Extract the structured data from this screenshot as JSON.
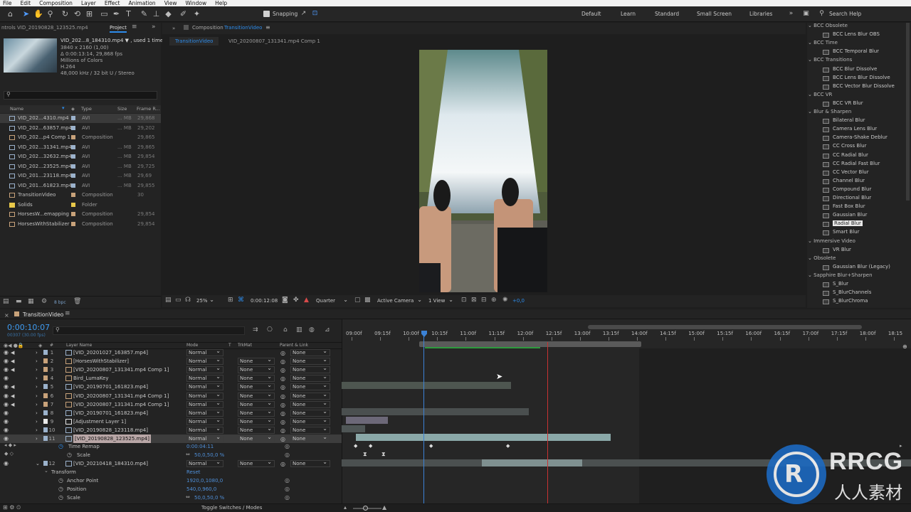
{
  "menu": [
    "File",
    "Edit",
    "Composition",
    "Layer",
    "Effect",
    "Animation",
    "View",
    "Window",
    "Help"
  ],
  "toolbar": {
    "snapping_label": "Snapping",
    "workspaces": [
      "Default",
      "Learn",
      "Standard",
      "Small Screen",
      "Libraries"
    ],
    "search_placeholder": "Search Help"
  },
  "project_panel": {
    "left_tab": "ntrols VID_20190828_123525.mp4",
    "tab": "Project",
    "preview": {
      "name": "VID_202...8_184310.mp4 ▼ , used 1 time",
      "res": "3840 x 2160 (1,00)",
      "duration": "Δ 0:00:13:14, 29,868 fps",
      "colors": "Millions of Colors",
      "codec": "H.264",
      "audio": "48,000 kHz / 32 bit U / Stereo"
    },
    "search_placeholder": "",
    "columns": [
      "Name",
      "Type",
      "Size",
      "Frame R..."
    ],
    "items": [
      {
        "name": "VID_202...4310.mp4",
        "type": "AVI",
        "size": "... MB",
        "rate": "29,868",
        "color": "#9bb2cc",
        "selected": true
      },
      {
        "name": "VID_202...63857.mp4",
        "type": "AVI",
        "size": "... MB",
        "rate": "29,202",
        "color": "#9bb2cc"
      },
      {
        "name": "VID_202...p4 Comp 1",
        "type": "Composition",
        "size": "",
        "rate": "29,865",
        "color": "#c8a27a"
      },
      {
        "name": "VID_202...31341.mp4",
        "type": "AVI",
        "size": "... MB",
        "rate": "29,865",
        "color": "#9bb2cc"
      },
      {
        "name": "VID_202...32632.mp4",
        "type": "AVI",
        "size": "... MB",
        "rate": "29,854",
        "color": "#9bb2cc"
      },
      {
        "name": "VID_202...23525.mp4",
        "type": "AVI",
        "size": "... MB",
        "rate": "29,725",
        "color": "#9bb2cc"
      },
      {
        "name": "VID_201...23118.mp4",
        "type": "AVI",
        "size": "... MB",
        "rate": "29,69",
        "color": "#9bb2cc"
      },
      {
        "name": "VID_201...61823.mp4",
        "type": "AVI",
        "size": "... MB",
        "rate": "29,855",
        "color": "#9bb2cc"
      },
      {
        "name": "TransitionVideo",
        "type": "Composition",
        "size": "",
        "rate": "30",
        "color": "#c8a27a"
      },
      {
        "name": "Solids",
        "type": "Folder",
        "size": "",
        "rate": "",
        "color": "#e8c84a"
      },
      {
        "name": "HorsesW...emapping",
        "type": "Composition",
        "size": "",
        "rate": "29,854",
        "color": "#c8a27a"
      },
      {
        "name": "HorsesWithStabilizer",
        "type": "Composition",
        "size": "",
        "rate": "29,854",
        "color": "#c8a27a"
      }
    ],
    "bpc": "8 bpc"
  },
  "composition_panel": {
    "header": "Composition",
    "comp_name": "TransitionVideo",
    "tabs": [
      "TransitionVideo",
      "VID_20200807_131341.mp4 Comp 1"
    ],
    "zoom": "25%",
    "timecode": "0:00:12:08",
    "resolution": "Quarter",
    "camera": "Active Camera",
    "views": "1 View",
    "exposure": "+0,0"
  },
  "effects_panel": {
    "groups": [
      {
        "name": "BCC Obsolete",
        "items": [
          "BCC Lens Blur OBS"
        ]
      },
      {
        "name": "BCC Time",
        "items": [
          "BCC Temporal Blur"
        ]
      },
      {
        "name": "BCC Transitions",
        "items": [
          "BCC Blur Dissolve",
          "BCC Lens Blur Dissolve",
          "BCC Vector Blur Dissolve"
        ]
      },
      {
        "name": "BCC VR",
        "items": [
          "BCC VR Blur"
        ]
      },
      {
        "name": "Blur & Sharpen",
        "items": [
          "Bilateral Blur",
          "Camera Lens Blur",
          "Camera-Shake Deblur",
          "CC Cross Blur",
          "CC Radial Blur",
          "CC Radial Fast Blur",
          "CC Vector Blur",
          "Channel Blur",
          "Compound Blur",
          "Directional Blur",
          "Fast Box Blur",
          "Gaussian Blur",
          "Radial Blur",
          "Smart Blur"
        ]
      },
      {
        "name": "Immersive Video",
        "items": [
          "VR Blur"
        ]
      },
      {
        "name": "Obsolete",
        "items": [
          "Gaussian Blur (Legacy)"
        ]
      },
      {
        "name": "Sapphire Blur+Sharpen",
        "items": [
          "S_Blur",
          "S_BlurChannels",
          "S_BlurChroma"
        ]
      }
    ],
    "selected": "Radial Blur"
  },
  "timeline": {
    "tab": "TransitionVideo",
    "timecode": "0:00:10:07",
    "frame_info": "00307 (30.00 fps)",
    "columns": {
      "layer_name": "Layer Name",
      "mode": "Mode",
      "t": "T",
      "trkmat": "TrkMat",
      "parent": "Parent & Link"
    },
    "ruler": [
      "09:00f",
      "09:15f",
      "10:00f",
      "10:15f",
      "11:00f",
      "11:15f",
      "12:00f",
      "12:15f",
      "13:00f",
      "13:15f",
      "14:00f",
      "14:15f",
      "15:00f",
      "15:15f",
      "16:00f",
      "16:15f",
      "17:00f",
      "17:15f",
      "18:00f",
      "18:15"
    ],
    "layers": [
      {
        "num": "1",
        "name": "[VID_20201027_163857.mp4]",
        "mode": "Normal",
        "trkmat": "",
        "parent": "None",
        "color": "#9bb2cc"
      },
      {
        "num": "2",
        "name": "[HorsesWithStabilizer]",
        "mode": "Normal",
        "trkmat": "None",
        "parent": "None",
        "color": "#c8a27a"
      },
      {
        "num": "3",
        "name": "[VID_20200807_131341.mp4 Comp 1]",
        "mode": "Normal",
        "trkmat": "None",
        "parent": "None",
        "color": "#c8a27a"
      },
      {
        "num": "4",
        "name": "Bird_LumaKey",
        "mode": "Normal",
        "trkmat": "None",
        "parent": "None",
        "color": "#c8a27a"
      },
      {
        "num": "5",
        "name": "[VID_20190701_161823.mp4]",
        "mode": "Normal",
        "trkmat": "None",
        "parent": "None",
        "color": "#9bb2cc"
      },
      {
        "num": "6",
        "name": "[VID_20200807_131341.mp4 Comp 1]",
        "mode": "Normal",
        "trkmat": "None",
        "parent": "None",
        "color": "#c8a27a"
      },
      {
        "num": "7",
        "name": "[VID_20200807_131341.mp4 Comp 1]",
        "mode": "Normal",
        "trkmat": "None",
        "parent": "None",
        "color": "#c8a27a"
      },
      {
        "num": "8",
        "name": "[VID_20190701_161823.mp4]",
        "mode": "Normal",
        "trkmat": "None",
        "parent": "None",
        "color": "#9bb2cc"
      },
      {
        "num": "9",
        "name": "[Adjustment Layer 1]",
        "mode": "Normal",
        "trkmat": "None",
        "parent": "None",
        "color": "#e8e8e8"
      },
      {
        "num": "10",
        "name": "[VID_20190828_123118.mp4]",
        "mode": "Normal",
        "trkmat": "None",
        "parent": "None",
        "color": "#9bb2cc"
      },
      {
        "num": "11",
        "name": "[VID_20190828_123525.mp4]",
        "mode": "Normal",
        "trkmat": "None",
        "parent": "None",
        "color": "#9bb2cc"
      }
    ],
    "layer11_props": {
      "time_remap_label": "Time Remap",
      "time_remap_value": "0:00:04:11",
      "scale_label": "Scale",
      "scale_value": "50,0,50,0 %"
    },
    "layer12": {
      "num": "12",
      "name": "[VID_20210418_184310.mp4]",
      "mode": "Normal",
      "trkmat": "None",
      "parent": "None"
    },
    "transform": {
      "label": "Transform",
      "reset": "Reset",
      "anchor_label": "Anchor Point",
      "anchor_value": "1920,0,1080,0",
      "position_label": "Position",
      "position_value": "540,0,960,0",
      "scale_label": "Scale",
      "scale_value": "50,0,50,0 %"
    },
    "footer": "Toggle Switches / Modes"
  },
  "watermark": {
    "brand": "RRCG",
    "sub": "人人素材"
  },
  "colors": {
    "accent": "#2d8ceb",
    "playhead": "#3b82d6",
    "work_area_end": "#c83232"
  }
}
